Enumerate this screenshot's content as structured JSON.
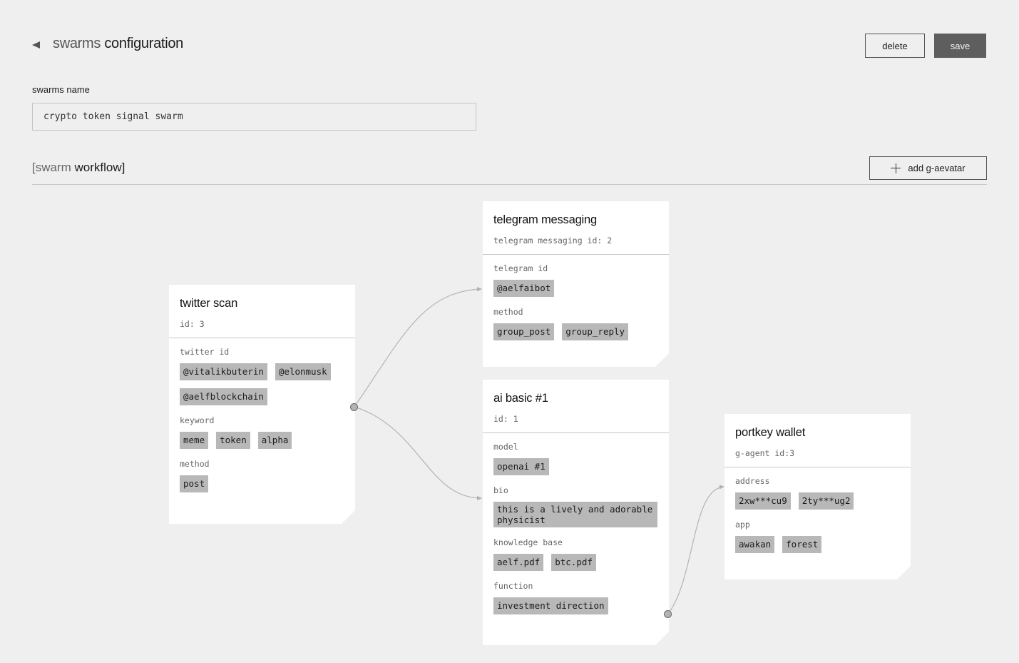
{
  "header": {
    "back_icon": "triangle-left-icon",
    "title_muted": "swarms",
    "title_strong": "configuration",
    "delete_label": "delete",
    "save_label": "save"
  },
  "name_field": {
    "label": "swarms name",
    "value": "crypto token signal swarm"
  },
  "workflow": {
    "title_open": "[",
    "title_muted": "swarm",
    "title_strong": "workflow]",
    "add_icon": "plus-icon",
    "add_label": "add g-aevatar"
  },
  "nodes": {
    "twitter": {
      "title": "twitter scan",
      "subtitle": "id: 3",
      "fields": [
        {
          "label": "twitter id",
          "values": [
            "@vitalikbuterin",
            "@elonmusk",
            "@aelfblockchain"
          ]
        },
        {
          "label": "keyword",
          "values": [
            "meme",
            "token",
            "alpha"
          ]
        },
        {
          "label": "method",
          "values": [
            "post"
          ]
        }
      ]
    },
    "telegram": {
      "title": "telegram messaging",
      "subtitle": "telegram messaging id: 2",
      "fields": [
        {
          "label": "telegram id",
          "values": [
            "@aelfaibot"
          ]
        },
        {
          "label": "method",
          "values": [
            "group_post",
            "group_reply"
          ]
        }
      ]
    },
    "ai": {
      "title": "ai basic #1",
      "subtitle": "id: 1",
      "fields": [
        {
          "label": "model",
          "values": [
            "openai #1"
          ]
        },
        {
          "label": "bio",
          "values": [
            "this is a lively and adorable physicist"
          ]
        },
        {
          "label": "knowledge base",
          "values": [
            "aelf.pdf",
            "btc.pdf"
          ]
        },
        {
          "label": "function",
          "values": [
            "investment direction"
          ]
        }
      ]
    },
    "portkey": {
      "title": "portkey wallet",
      "subtitle": "g-agent id:3",
      "fields": [
        {
          "label": "address",
          "values": [
            "2xw***cu9",
            "2ty***ug2"
          ]
        },
        {
          "label": "app",
          "values": [
            "awakan",
            "forest"
          ]
        }
      ]
    }
  },
  "connections": [
    {
      "from": "twitter scan",
      "to": "telegram messaging"
    },
    {
      "from": "twitter scan",
      "to": "ai basic #1"
    },
    {
      "from": "ai basic #1",
      "to": "portkey wallet"
    }
  ],
  "colors": {
    "background": "#efefef",
    "card": "#ffffff",
    "chip": "#b8b8b8",
    "save_button": "#5e5e5e",
    "connector": "#b0b0b0"
  }
}
